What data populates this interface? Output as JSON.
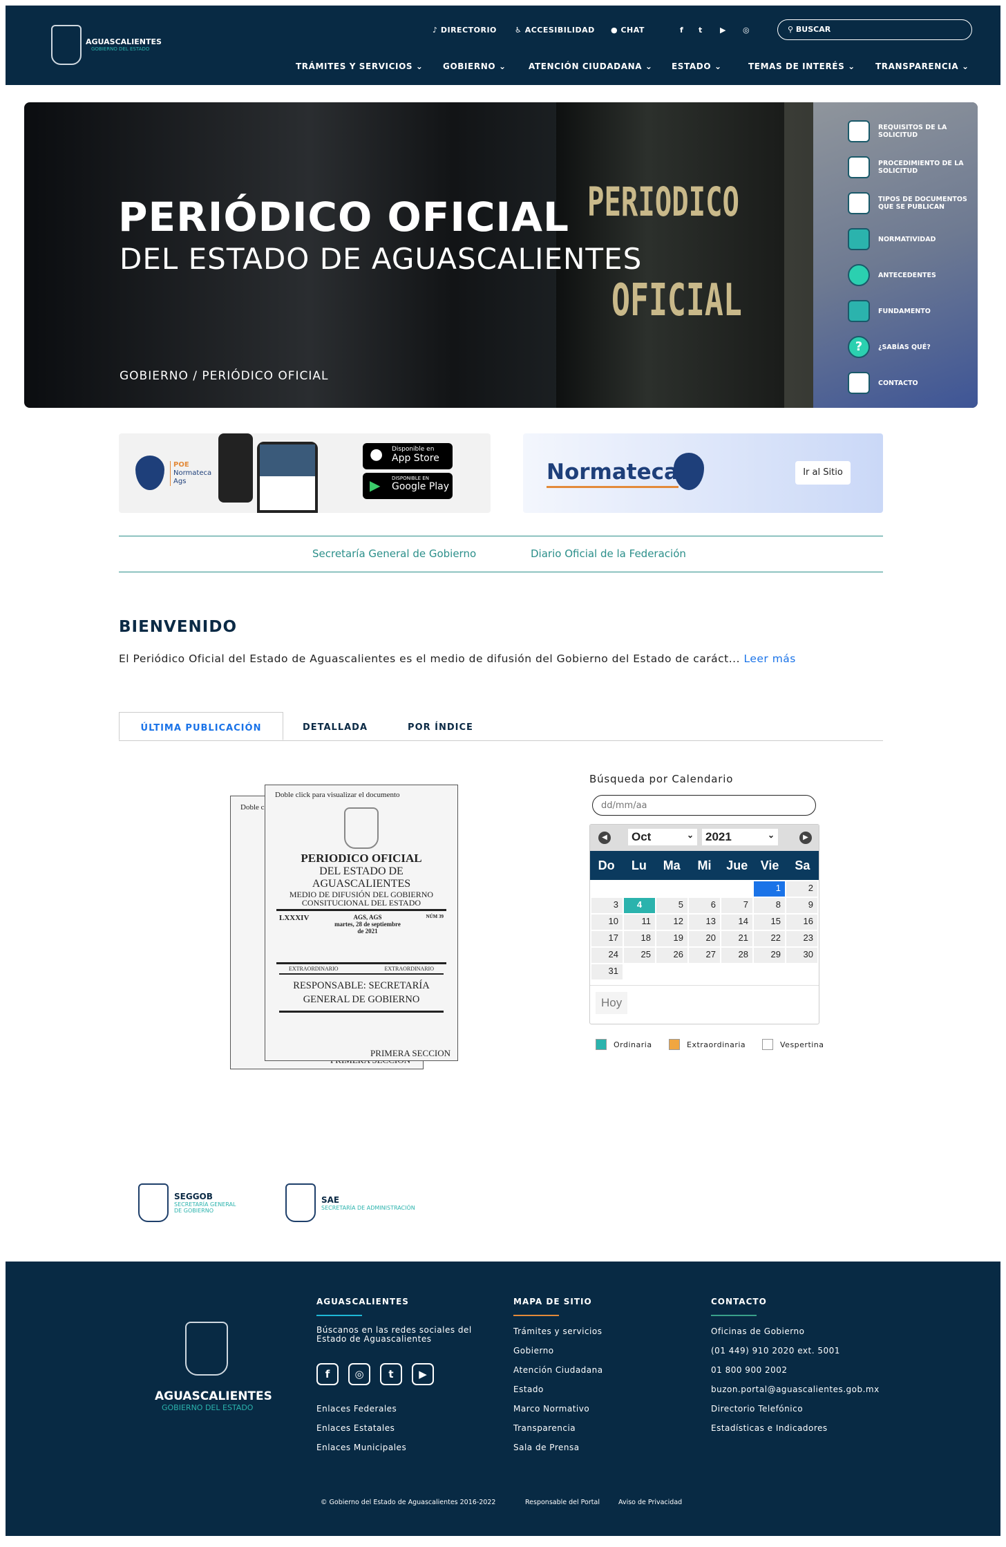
{
  "header": {
    "logo_title": "AGUASCALIENTES",
    "logo_subtitle": "GOBIERNO DEL ESTADO",
    "top_links": [
      {
        "icon": "phone-icon",
        "label": "DIRECTORIO"
      },
      {
        "icon": "accessibility-icon",
        "label": "ACCESIBILIDAD"
      },
      {
        "icon": "chat-icon",
        "label": "CHAT"
      }
    ],
    "social": [
      "facebook-icon",
      "twitter-icon",
      "youtube-icon",
      "instagram-icon"
    ],
    "search_label": "BUSCAR",
    "nav": [
      "TRÁMITES Y SERVICIOS",
      "GOBIERNO",
      "ATENCIÓN CIUDADANA",
      "ESTADO",
      "TEMAS DE INTERÉS",
      "TRANSPARENCIA"
    ]
  },
  "hero": {
    "title": "PERIÓDICO OFICIAL",
    "subtitle": "DEL ESTADO DE AGUASCALIENTES",
    "breadcrumb": "GOBIERNO / PERIÓDICO OFICIAL",
    "book_text_1": "PERIODICO",
    "book_text_2": "OFICIAL",
    "panel": [
      {
        "label": "REQUISITOS DE LA SOLICITUD",
        "icon": "documents-check-icon"
      },
      {
        "label": "PROCEDIMIENTO DE LA SOLICITUD",
        "icon": "document-pen-icon"
      },
      {
        "label": "TIPOS DE DOCUMENTOS QUE SE PUBLICAN",
        "icon": "documents-icon"
      },
      {
        "label": "NORMATIVIDAD",
        "icon": "gavel-icon"
      },
      {
        "label": "ANTECEDENTES",
        "icon": "magnifier-check-icon"
      },
      {
        "label": "FUNDAMENTO",
        "icon": "book-icon"
      },
      {
        "label": "¿SABÍAS QUÉ?",
        "icon": "question-icon"
      },
      {
        "label": "CONTACTO",
        "icon": "monitor-icon"
      }
    ]
  },
  "banners": {
    "poe_lines": [
      "POE",
      "Normateca",
      "Ags"
    ],
    "app_store_small": "Disponible en",
    "app_store": "App Store",
    "google_small": "DISPONIBLE EN",
    "google": "Google Play",
    "normateca": "Normateca",
    "ir_al_sitio": "Ir al Sitio"
  },
  "links": [
    "Secretaría General de Gobierno",
    "Diario Oficial de la Federación"
  ],
  "welcome": {
    "title": "BIENVENIDO",
    "text": "El Periódico Oficial del Estado de Aguascalientes es el medio de difusión del Gobierno del Estado de caráct",
    "more": "Leer más"
  },
  "tabs": [
    "ÚLTIMA PUBLICACIÓN",
    "DETALLADA",
    "POR ÍNDICE"
  ],
  "document": {
    "hint": "Doble click para visualizar el documento",
    "back_hint": "Doble c",
    "title": "PERIODICO OFICIAL",
    "line2": "DEL ESTADO DE",
    "line3": "AGUASCALIENTES",
    "line4": "MEDIO DE DIFUSIÓN DEL GOBIERNO",
    "line5": "CONSITUCIONAL DEL ESTADO",
    "volume": "LXXXIV",
    "place": "AGS, AGS",
    "date": "martes, 28 de septiembre de 2021",
    "number": "NÚM 39",
    "type_left": "EXTRAORDINARIO",
    "type_right": "EXTRAORDINARIO",
    "responsible": "RESPONSABLE: SECRETARÍA GENERAL DE GOBIERNO",
    "section": "PRIMERA SECCION"
  },
  "calendar": {
    "title": "Búsqueda por Calendario",
    "placeholder": "dd/mm/aa",
    "month": "Oct",
    "year": "2021",
    "weekdays": [
      "Do",
      "Lu",
      "Ma",
      "Mi",
      "Jue",
      "Vie",
      "Sa"
    ],
    "first_weekday": 5,
    "days_in_month": 31,
    "selected_day": 1,
    "ordinaria_day": 4,
    "today_button": "Hoy",
    "legend": [
      {
        "label": "Ordinaria",
        "color": "#2bb3ad"
      },
      {
        "label": "Extraordinaria",
        "color": "#f0a640"
      },
      {
        "label": "Vespertina",
        "color": "#ffffff"
      }
    ]
  },
  "agencies": [
    {
      "name": "SEGGOB",
      "desc": "SECRETARÍA GENERAL DE GOBIERNO"
    },
    {
      "name": "SAE",
      "desc": "SECRETARÍA DE ADMINISTRACIÓN"
    }
  ],
  "footer": {
    "logo_title": "AGUASCALIENTES",
    "logo_subtitle": "GOBIERNO DEL ESTADO",
    "col1": {
      "title": "AGUASCALIENTES",
      "text": "Búscanos en las redes sociales del Estado de Aguascalientes",
      "social": [
        "facebook-icon",
        "instagram-icon",
        "twitter-icon",
        "youtube-icon"
      ],
      "links": [
        "Enlaces Federales",
        "Enlaces Estatales",
        "Enlaces Municipales"
      ]
    },
    "col2": {
      "title": "MAPA DE SITIO",
      "links": [
        "Trámites y servicios",
        "Gobierno",
        "Atención Ciudadana",
        "Estado",
        "Marco Normativo",
        "Transparencia",
        "Sala de Prensa"
      ]
    },
    "col3": {
      "title": "CONTACTO",
      "links": [
        "Oficinas de Gobierno",
        "(01 449) 910 2020 ext. 5001",
        "01 800 900 2002",
        "buzon.portal@aguascalientes.gob.mx",
        "Directorio Telefónico",
        "Estadísticas e Indicadores"
      ]
    },
    "copyright": "© Gobierno del Estado de Aguascalientes 2016-2022",
    "responsible": "Responsable del Portal",
    "privacy": "Aviso de Privacidad"
  },
  "colors": {
    "navy": "#082a44",
    "teal": "#2bb3ad",
    "accent_blue": "#1a73e8",
    "orange": "#e38a3a"
  }
}
